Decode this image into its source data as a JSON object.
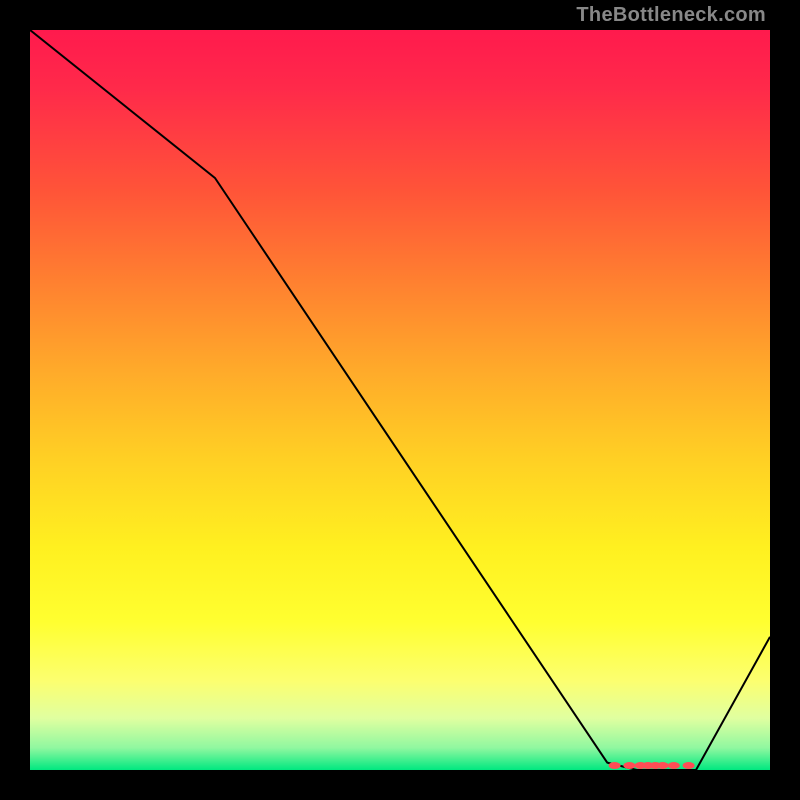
{
  "attribution": "TheBottleneck.com",
  "chart_data": {
    "type": "line",
    "title": "",
    "xlabel": "",
    "ylabel": "",
    "xlim": [
      0,
      100
    ],
    "ylim": [
      0,
      100
    ],
    "series": [
      {
        "name": "curve",
        "color": "#000000",
        "x": [
          0,
          25,
          78,
          82,
          90,
          100
        ],
        "y": [
          100,
          80,
          1,
          0,
          0,
          18
        ]
      }
    ],
    "markers": [
      {
        "name": "cluster",
        "color": "#ff4d55",
        "style": "flat-ellipse",
        "x": [
          79.0,
          81.0,
          82.5,
          83.5,
          84.5,
          85.5,
          87.0,
          89.0
        ],
        "y": [
          0.6,
          0.6,
          0.6,
          0.6,
          0.6,
          0.6,
          0.6,
          0.6
        ]
      }
    ]
  }
}
